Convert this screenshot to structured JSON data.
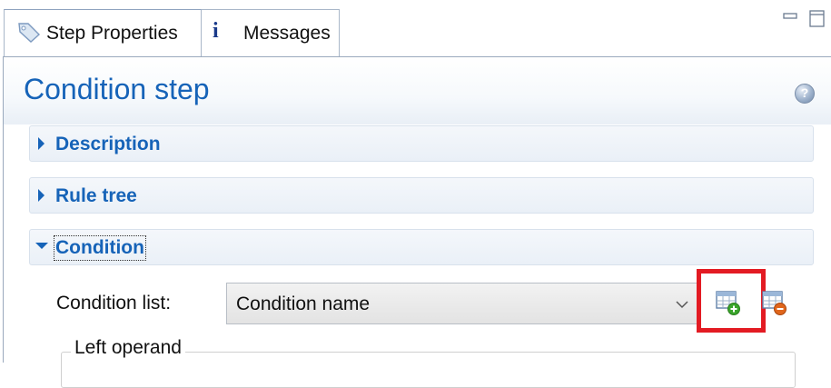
{
  "tabs": {
    "step_properties_label": "Step Properties",
    "messages_label": "Messages",
    "messages_icon_glyph": "i"
  },
  "panel": {
    "title": "Condition step",
    "help_glyph": "?"
  },
  "sections": [
    {
      "label": "Description",
      "expanded": false
    },
    {
      "label": "Rule tree",
      "expanded": false
    },
    {
      "label": "Condition",
      "expanded": true
    }
  ],
  "condition": {
    "list_label": "Condition list:",
    "selected_value": "Condition name",
    "left_operand_label": "Left operand"
  },
  "colors": {
    "accent_blue": "#1663b8",
    "highlight_red": "#e31b23",
    "add_green": "#3aa52b",
    "remove_orange": "#e0661c"
  },
  "icons": {
    "step_tab": "tag-icon",
    "messages_tab": "info-icon",
    "help": "help-icon",
    "add": "add-condition-icon",
    "remove": "remove-condition-icon"
  }
}
